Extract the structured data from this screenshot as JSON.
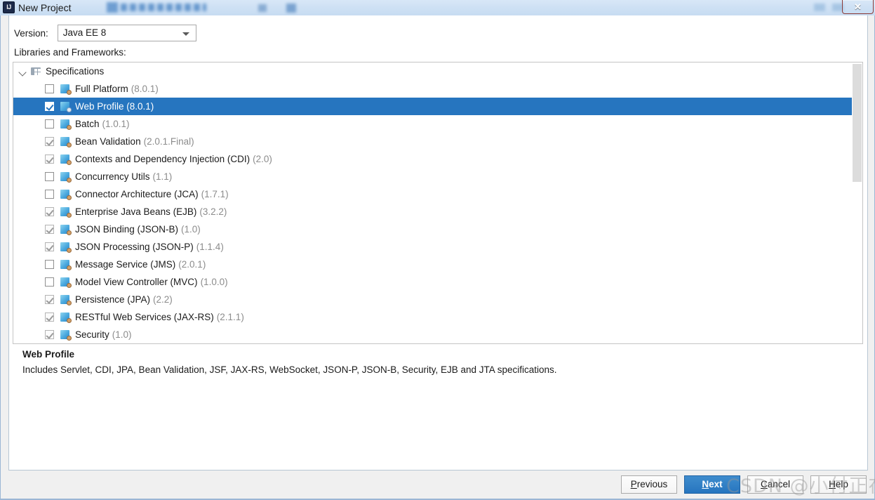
{
  "window": {
    "title": "New Project",
    "app_icon_text": "IJ",
    "close_label": "✕"
  },
  "form": {
    "version_label": "Version:",
    "version_value": "Java EE 8",
    "libraries_label": "Libraries and Frameworks:"
  },
  "tree": {
    "root": {
      "label": "Specifications",
      "expanded": true
    },
    "items": [
      {
        "label": "Full Platform",
        "version": "(8.0.1)",
        "checked": false,
        "enabled": true,
        "selected": false
      },
      {
        "label": "Web Profile (8.0.1)",
        "version": "",
        "checked": true,
        "enabled": true,
        "selected": true
      },
      {
        "label": "Batch",
        "version": "(1.0.1)",
        "checked": false,
        "enabled": true,
        "selected": false
      },
      {
        "label": "Bean Validation",
        "version": "(2.0.1.Final)",
        "checked": true,
        "enabled": false,
        "selected": false
      },
      {
        "label": "Contexts and Dependency Injection (CDI)",
        "version": "(2.0)",
        "checked": true,
        "enabled": false,
        "selected": false
      },
      {
        "label": "Concurrency Utils",
        "version": "(1.1)",
        "checked": false,
        "enabled": true,
        "selected": false
      },
      {
        "label": "Connector Architecture (JCA)",
        "version": "(1.7.1)",
        "checked": false,
        "enabled": true,
        "selected": false
      },
      {
        "label": "Enterprise Java Beans (EJB)",
        "version": "(3.2.2)",
        "checked": true,
        "enabled": false,
        "selected": false
      },
      {
        "label": "JSON Binding (JSON-B)",
        "version": "(1.0)",
        "checked": true,
        "enabled": false,
        "selected": false
      },
      {
        "label": "JSON Processing (JSON-P)",
        "version": "(1.1.4)",
        "checked": true,
        "enabled": false,
        "selected": false
      },
      {
        "label": "Message Service (JMS)",
        "version": "(2.0.1)",
        "checked": false,
        "enabled": true,
        "selected": false
      },
      {
        "label": "Model View Controller (MVC)",
        "version": "(1.0.0)",
        "checked": false,
        "enabled": true,
        "selected": false
      },
      {
        "label": "Persistence (JPA)",
        "version": "(2.2)",
        "checked": true,
        "enabled": false,
        "selected": false
      },
      {
        "label": "RESTful Web Services (JAX-RS)",
        "version": "(2.1.1)",
        "checked": true,
        "enabled": false,
        "selected": false
      },
      {
        "label": "Security",
        "version": "(1.0)",
        "checked": true,
        "enabled": false,
        "selected": false
      }
    ]
  },
  "description": {
    "title": "Web Profile",
    "text": "Includes Servlet, CDI, JPA, Bean Validation, JSF, JAX-RS, WebSocket, JSON-P, JSON-B, Security, EJB and JTA specifications."
  },
  "footer": {
    "buttons": [
      {
        "label": "Previous",
        "mnemonic": "P",
        "primary": false
      },
      {
        "label": "Next",
        "mnemonic": "N",
        "primary": true
      },
      {
        "label": "Cancel",
        "mnemonic": "C",
        "primary": false
      },
      {
        "label": "Help",
        "mnemonic": "H",
        "primary": false
      }
    ]
  },
  "watermark": {
    "text": "CSDN @小付正在努力"
  },
  "colors": {
    "selection_blue": "#2675bf",
    "primary_button": "#2675bf",
    "title_bar": "#cfe1f4",
    "close_red": "#c43029",
    "version_gray": "#8c8c8c"
  }
}
